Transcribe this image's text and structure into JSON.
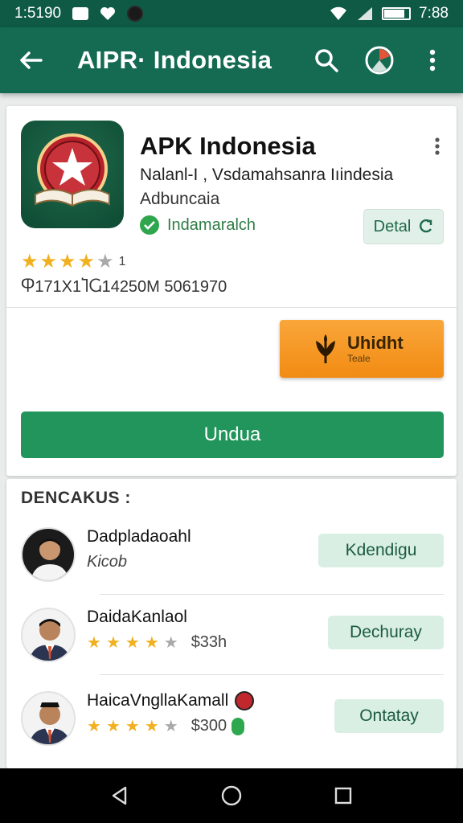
{
  "status_bar": {
    "time_left": "1:5190",
    "time_right": "7:88"
  },
  "app_bar": {
    "title": "AIPR· Indonesia"
  },
  "app_card": {
    "name": "APK Indonesia",
    "desc_line1": "Nalanl-I , Vsdamahsanra Iıindesia",
    "desc_line2": "Adbuncaia",
    "verified_label": "Indamaralch",
    "detail_button": "Detal",
    "rating": {
      "stars": 4.5,
      "count": "1"
    },
    "meta": "Ⴔ171X1ႨႺ14250M 5061970",
    "promo_button": {
      "label": "Uhidht",
      "sub": "Teale"
    },
    "download_button": "Undua",
    "colors": {
      "accent": "#21955c",
      "promo": "#f28b13",
      "header": "#146b52"
    }
  },
  "developers": {
    "section_title": "DENCAKUS :",
    "items": [
      {
        "name": "Dadpladaoahl",
        "sub": "Kicob",
        "action": "Kdendigu"
      },
      {
        "name": "DaidaKanlaol",
        "rating": 4.5,
        "price": "$33h",
        "action": "Dechuray"
      },
      {
        "name": "HaicaVnglla​Kamall",
        "rating": 4.5,
        "price": "$300",
        "action": "Ontatay"
      }
    ]
  },
  "icons": {
    "back": "arrow-left-icon",
    "search": "search-icon",
    "account": "account-circle-icon",
    "more": "more-vert-icon",
    "nav_back": "triangle-back-icon",
    "nav_home": "circle-home-icon",
    "nav_recents": "square-recents-icon"
  }
}
